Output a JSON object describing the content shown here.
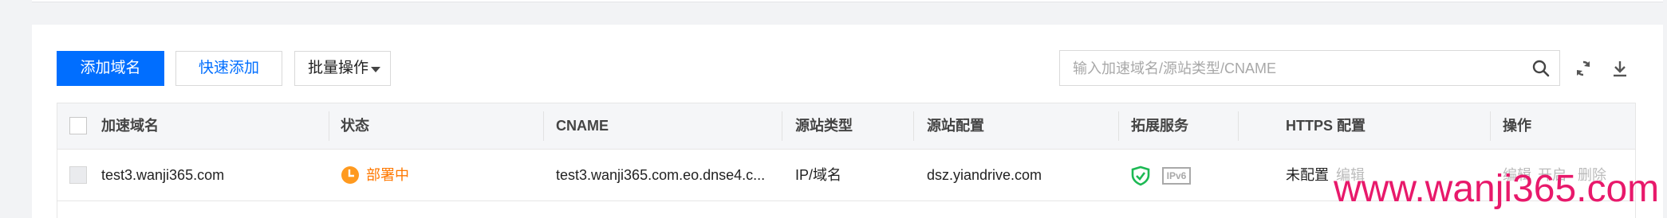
{
  "toolbar": {
    "add_domain_label": "添加域名",
    "quick_add_label": "快速添加",
    "batch_ops_label": "批量操作",
    "search_placeholder": "输入加速域名/源站类型/CNAME",
    "search_value": ""
  },
  "icons": {
    "search": "search-icon",
    "refresh": "refresh-icon",
    "download": "download-icon",
    "status": "clock-icon",
    "security": "shield-check-icon"
  },
  "colors": {
    "primary": "#006eff",
    "status_deploying": "#ff7800",
    "shield": "#1db954",
    "watermark": "#e8196b"
  },
  "table": {
    "columns": [
      "加速域名",
      "状态",
      "CNAME",
      "源站类型",
      "源站配置",
      "拓展服务",
      "HTTPS 配置",
      "操作"
    ],
    "rows": [
      {
        "domain": "test3.wanji365.com",
        "status": "部署中",
        "cname": "test3.wanji365.com.eo.dnse4.c...",
        "origin_type": "IP/域名",
        "origin_config": "dsz.yiandrive.com",
        "ipv6_badge": "IPv6",
        "https": "未配置",
        "https_action": "编辑",
        "actions": [
          "编辑",
          "开启",
          "删除"
        ]
      }
    ]
  },
  "watermark": "www.wanji365.com"
}
